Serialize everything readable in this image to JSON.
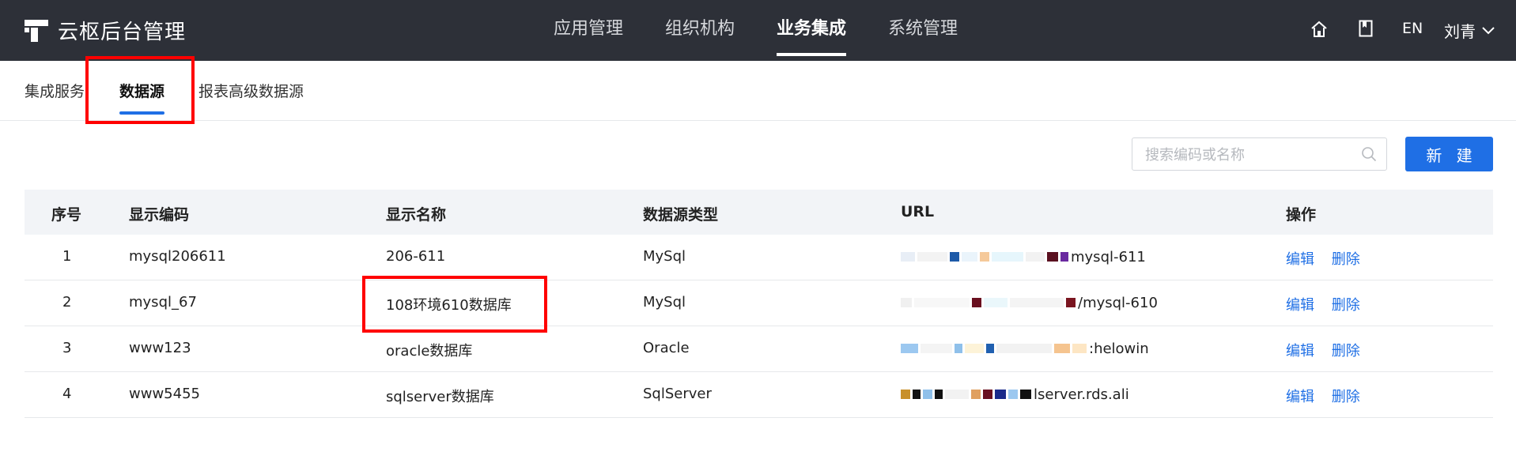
{
  "header": {
    "brand": "云枢后台管理",
    "nav": [
      {
        "label": "应用管理",
        "active": false
      },
      {
        "label": "组织机构",
        "active": false
      },
      {
        "label": "业务集成",
        "active": true
      },
      {
        "label": "系统管理",
        "active": false
      }
    ],
    "lang": "EN",
    "user": "刘青"
  },
  "subtabs": [
    {
      "label": "集成服务",
      "active": false
    },
    {
      "label": "数据源",
      "active": true
    },
    {
      "label": "报表高级数据源",
      "active": false
    }
  ],
  "toolbar": {
    "search_placeholder": "搜索编码或名称",
    "new_label": "新 建"
  },
  "table": {
    "columns": [
      "序号",
      "显示编码",
      "显示名称",
      "数据源类型",
      "URL",
      "操作"
    ],
    "rows": [
      {
        "seq": "1",
        "code": "mysql206611",
        "name": "206-611",
        "type": "MySql",
        "url_visible": "mysql-611"
      },
      {
        "seq": "2",
        "code": "mysql_67",
        "name": "108环境610数据库",
        "type": "MySql",
        "url_visible": "/mysql-610"
      },
      {
        "seq": "3",
        "code": "www123",
        "name": "oracle数据库",
        "type": "Oracle",
        "url_visible": ":helowin"
      },
      {
        "seq": "4",
        "code": "www5455",
        "name": "sqlserver数据库",
        "type": "SqlServer",
        "url_visible": "lserver.rds.ali"
      }
    ],
    "ops": {
      "edit": "编辑",
      "delete": "删除"
    }
  },
  "colors": {
    "header_bg": "#2d3038",
    "accent": "#1f6fe5",
    "highlight": "#ff0000"
  }
}
